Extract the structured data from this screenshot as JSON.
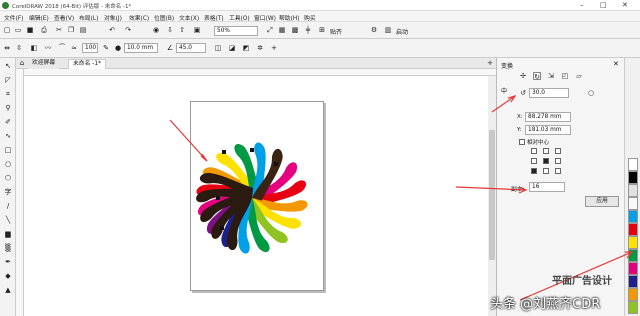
{
  "window": {
    "title": "CorelDRAW 2018 (64-Bit) 评估版 - 未命名 -1*"
  },
  "menu": [
    "文件(F)",
    "编辑(E)",
    "查看(V)",
    "布局(L)",
    "对象(J)",
    "效果(C)",
    "位图(B)",
    "文本(X)",
    "表格(T)",
    "工具(O)",
    "窗口(W)",
    "帮助(H)",
    "购买"
  ],
  "standard_toolbar": {
    "zoom": "50%",
    "snap_label": "贴齐",
    "launch_label": "启动"
  },
  "property_bar": {
    "outline_pct": "100",
    "outline_width": "10.0 mm",
    "angle": "45.0"
  },
  "doc_tabs": [
    {
      "label": "欢迎屏幕"
    },
    {
      "label": "未命名 -1*"
    }
  ],
  "docker": {
    "title": "变换",
    "rotation_label": "中",
    "rotation_value": "30.0",
    "x_label": "X:",
    "x_value": "88.278 mm",
    "y_label": "Y:",
    "y_value": "181.03 mm",
    "relative_center_label": "相对中心",
    "copies_label": "副本:",
    "copies_value": "16",
    "apply_label": "应用"
  },
  "palette": [
    "#ffffff",
    "#000000",
    "#e0e0e0",
    "#f8f8f8",
    "#00a0e9",
    "#e60012",
    "#ffe100",
    "#009944",
    "#e4007f",
    "#1d2088",
    "#f39800",
    "#8fc31f"
  ],
  "watermark": {
    "line1": "平面广告设计",
    "line2": "头条 @刘燕齐CDR"
  },
  "icons": {
    "pan": "move-icon",
    "rotate": "rotate-icon",
    "scale": "scale-icon",
    "size": "size-icon",
    "skew": "skew-icon"
  },
  "colors": {
    "accent": "#e53935",
    "title_bar": "#ffffff"
  }
}
